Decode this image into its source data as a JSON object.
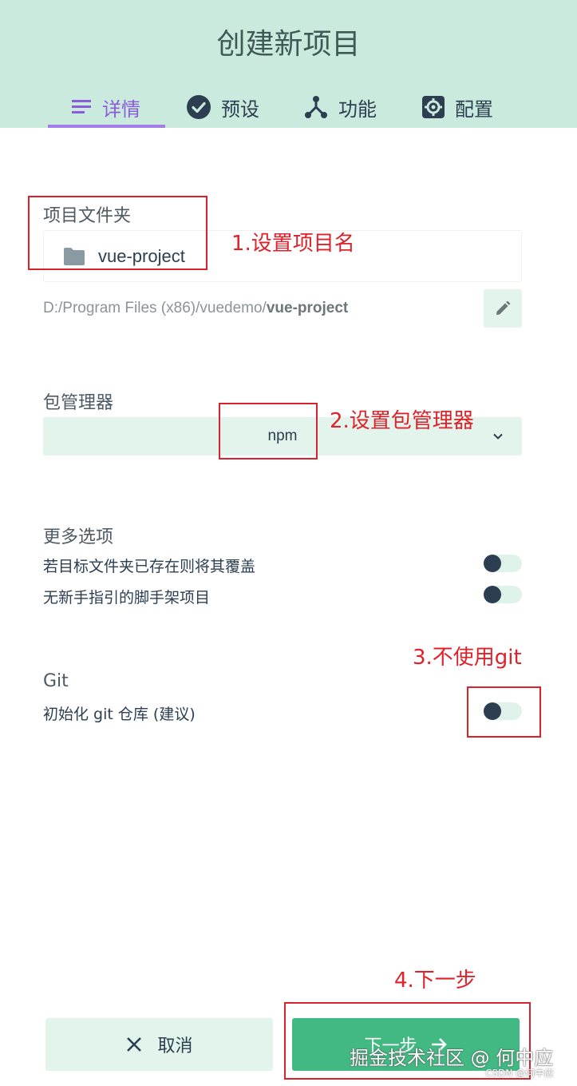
{
  "header": {
    "title": "创建新项目",
    "tabs": [
      {
        "label": "详情",
        "icon": "list-icon",
        "active": true
      },
      {
        "label": "预设",
        "icon": "check-circle-icon",
        "active": false
      },
      {
        "label": "功能",
        "icon": "fork-icon",
        "active": false
      },
      {
        "label": "配置",
        "icon": "gear-icon",
        "active": false
      }
    ]
  },
  "folder": {
    "label": "项目文件夹",
    "name": "vue-project",
    "path_prefix": "D:/Program Files (x86)/vuedemo/",
    "path_name": "vue-project"
  },
  "package_manager": {
    "label": "包管理器",
    "value": "npm"
  },
  "more_options": {
    "label": "更多选项",
    "items": [
      {
        "label": "若目标文件夹已存在则将其覆盖",
        "enabled": false
      },
      {
        "label": "无新手指引的脚手架项目",
        "enabled": false
      }
    ]
  },
  "git": {
    "label": "Git",
    "init_label": "初始化 git 仓库 (建议)",
    "enabled": false
  },
  "annotations": {
    "step1": "1.设置项目名",
    "step2": "2.设置包管理器",
    "step3": "3.不使用git",
    "step4": "4.下一步"
  },
  "footer": {
    "cancel_label": "取消",
    "next_label": "下一步"
  },
  "watermark": {
    "main": "掘金技术社区 @ 何中应",
    "small": "CSDN @何中应"
  },
  "colors": {
    "header_bg": "#c9eadc",
    "active_tab": "#8a5cdb",
    "primary": "#42b983",
    "light_green": "#e2f4ec",
    "annotation": "#d9232b"
  }
}
